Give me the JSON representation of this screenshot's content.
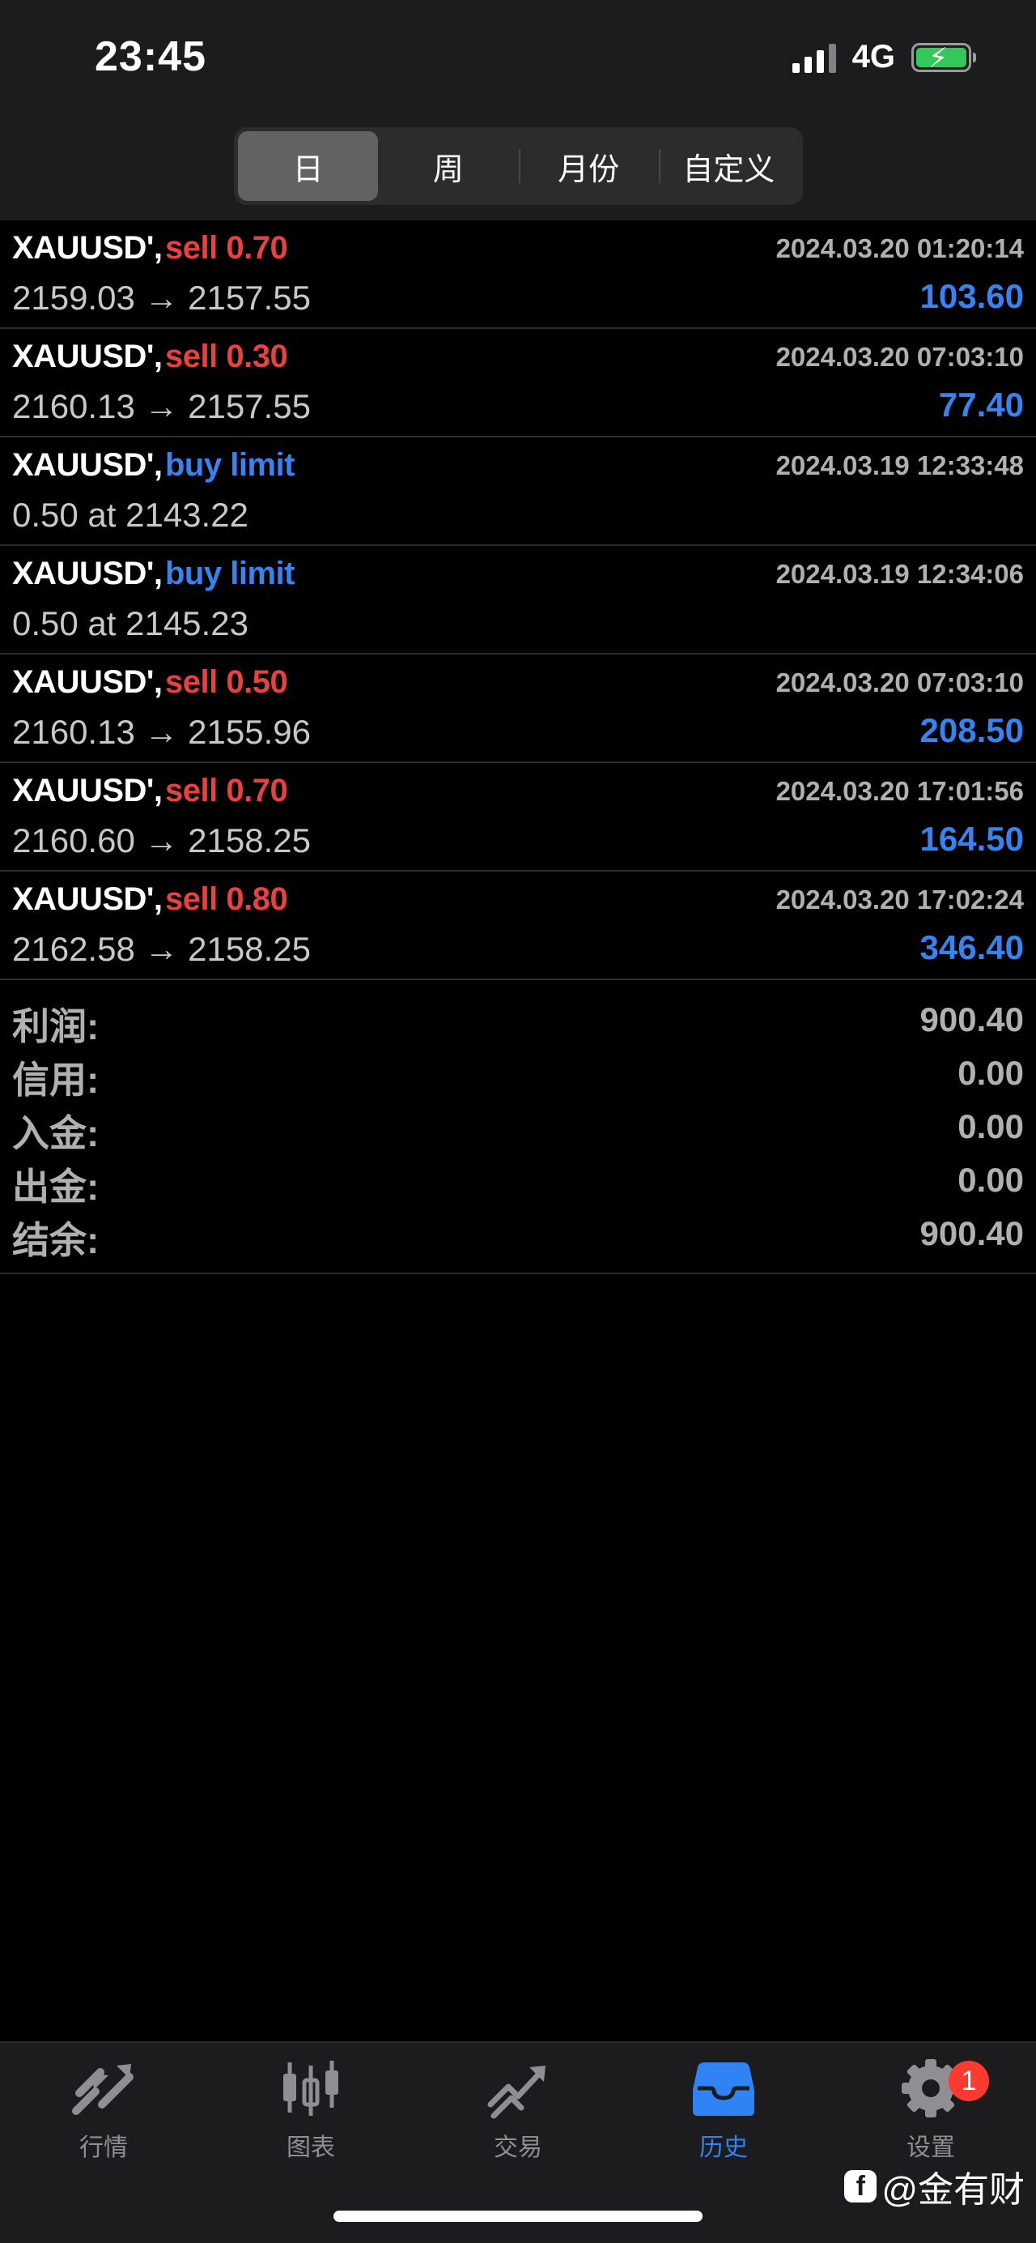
{
  "status_bar": {
    "time": "23:45",
    "network": "4G"
  },
  "period_tabs": [
    {
      "label": "日",
      "active": true
    },
    {
      "label": "周",
      "active": false
    },
    {
      "label": "月份",
      "active": false
    },
    {
      "label": "自定义",
      "active": false
    }
  ],
  "orders": [
    {
      "symbol": "XAUUSD',",
      "action": "sell 0.70",
      "type": "sell",
      "time": "2024.03.20 01:20:14",
      "detail": "2159.03 → 2157.55",
      "profit": "103.60"
    },
    {
      "symbol": "XAUUSD',",
      "action": "sell 0.30",
      "type": "sell",
      "time": "2024.03.20 07:03:10",
      "detail": "2160.13 → 2157.55",
      "profit": "77.40"
    },
    {
      "symbol": "XAUUSD',",
      "action": "buy limit",
      "type": "buy",
      "time": "2024.03.19 12:33:48",
      "detail": "0.50 at 2143.22",
      "profit": ""
    },
    {
      "symbol": "XAUUSD',",
      "action": "buy limit",
      "type": "buy",
      "time": "2024.03.19 12:34:06",
      "detail": "0.50 at 2145.23",
      "profit": ""
    },
    {
      "symbol": "XAUUSD',",
      "action": "sell 0.50",
      "type": "sell",
      "time": "2024.03.20 07:03:10",
      "detail": "2160.13 → 2155.96",
      "profit": "208.50"
    },
    {
      "symbol": "XAUUSD',",
      "action": "sell 0.70",
      "type": "sell",
      "time": "2024.03.20 17:01:56",
      "detail": "2160.60 → 2158.25",
      "profit": "164.50"
    },
    {
      "symbol": "XAUUSD',",
      "action": "sell 0.80",
      "type": "sell",
      "time": "2024.03.20 17:02:24",
      "detail": "2162.58 → 2158.25",
      "profit": "346.40"
    }
  ],
  "summary": [
    {
      "label": "利润:",
      "value": "900.40"
    },
    {
      "label": "信用:",
      "value": "0.00"
    },
    {
      "label": "入金:",
      "value": "0.00"
    },
    {
      "label": "出金:",
      "value": "0.00"
    },
    {
      "label": "结余:",
      "value": "900.40"
    }
  ],
  "tabbar": [
    {
      "label": "行情",
      "icon": "quotes-icon",
      "active": false
    },
    {
      "label": "图表",
      "icon": "chart-icon",
      "active": false
    },
    {
      "label": "交易",
      "icon": "trade-icon",
      "active": false
    },
    {
      "label": "历史",
      "icon": "history-icon",
      "active": true
    },
    {
      "label": "设置",
      "icon": "settings-icon",
      "active": false,
      "badge": "1"
    }
  ],
  "watermark": {
    "logo": "f",
    "text": "@金有财"
  },
  "colors": {
    "sell": "#e94040",
    "buy": "#3584f2",
    "profit": "#3584f2",
    "active_tab": "#2f83f5"
  }
}
